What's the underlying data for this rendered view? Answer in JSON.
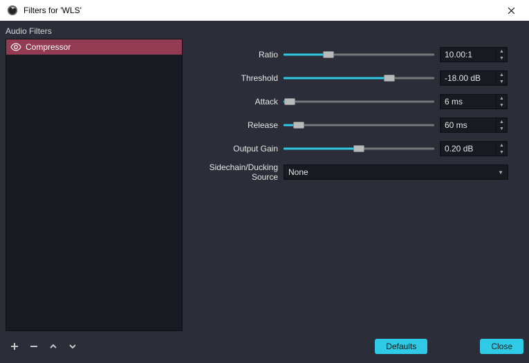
{
  "window": {
    "title": "Filters for 'WLS'"
  },
  "section_label": "Audio Filters",
  "filters": [
    {
      "name": "Compressor",
      "selected": true
    }
  ],
  "params": {
    "ratio": {
      "label": "Ratio",
      "value": "10.00:1",
      "fill_pct": 30
    },
    "threshold": {
      "label": "Threshold",
      "value": "-18.00 dB",
      "fill_pct": 70
    },
    "attack": {
      "label": "Attack",
      "value": "6 ms",
      "fill_pct": 4
    },
    "release": {
      "label": "Release",
      "value": "60 ms",
      "fill_pct": 10
    },
    "output_gain": {
      "label": "Output Gain",
      "value": "0.20 dB",
      "fill_pct": 50
    },
    "sidechain": {
      "label": "Sidechain/Ducking Source",
      "value": "None"
    }
  },
  "buttons": {
    "defaults": "Defaults",
    "close": "Close"
  }
}
